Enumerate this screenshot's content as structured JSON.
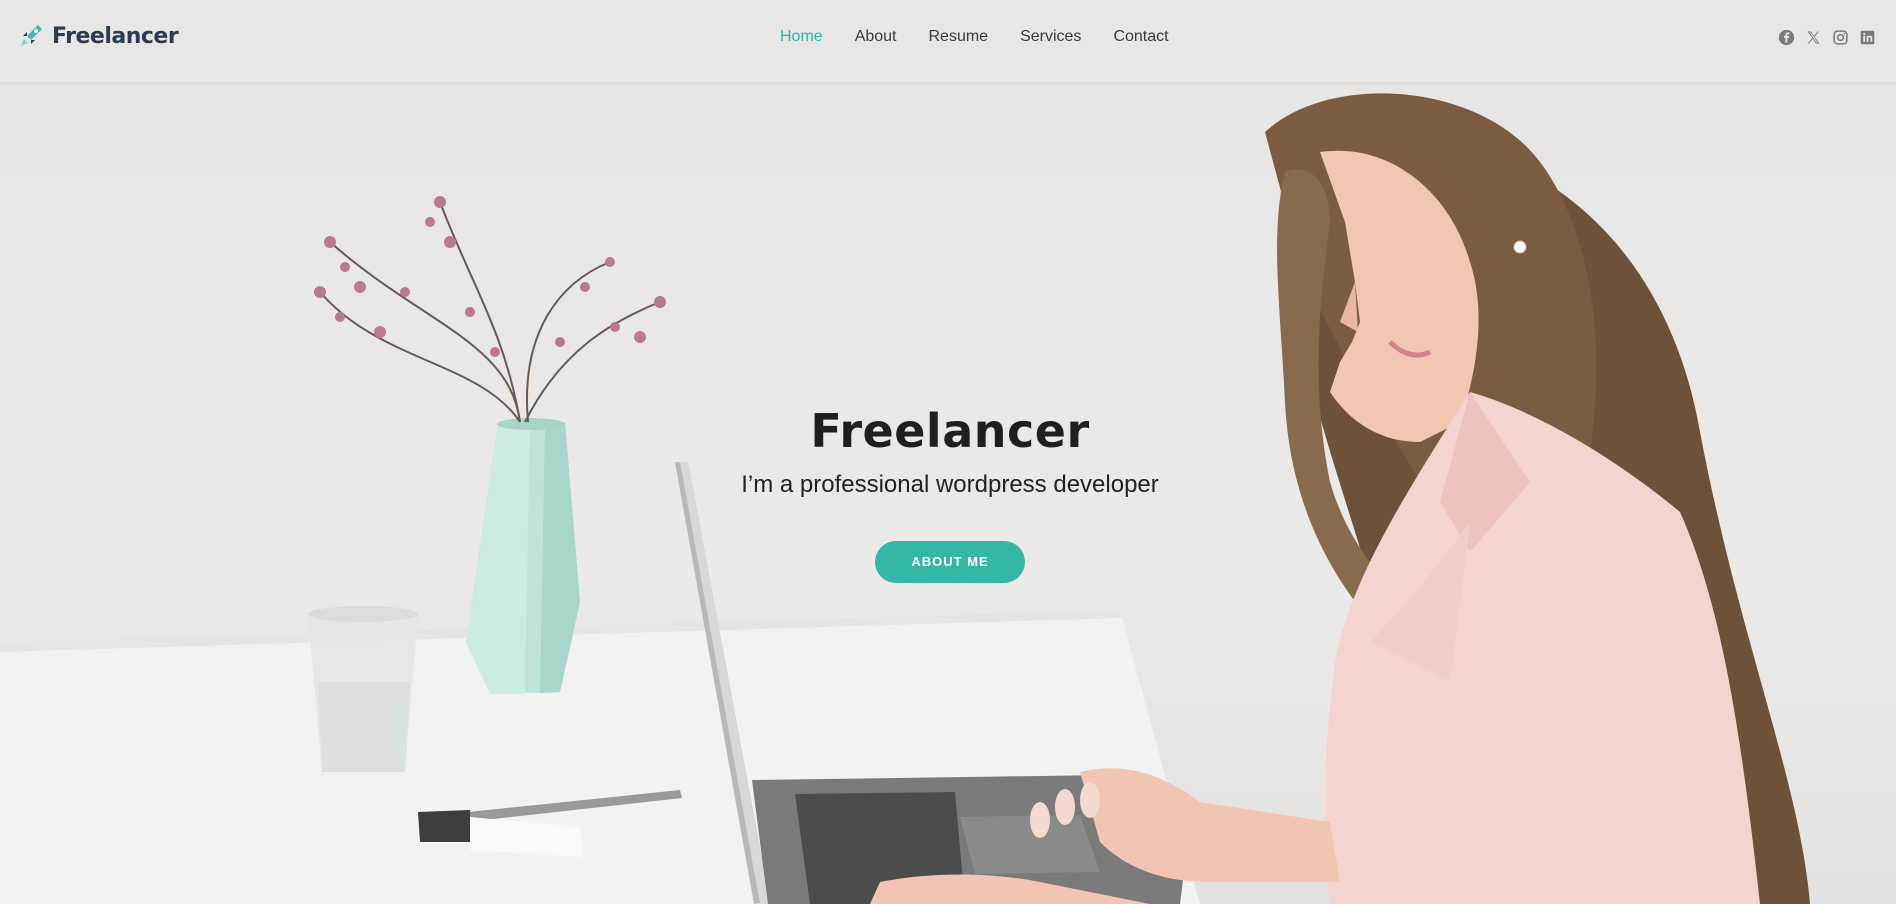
{
  "brand": {
    "name": "Freelancer",
    "accent_color": "#34b7a5",
    "logo_icon": "rocket-icon"
  },
  "nav": {
    "items": [
      {
        "label": "Home",
        "active": true
      },
      {
        "label": "About",
        "active": false
      },
      {
        "label": "Resume",
        "active": false
      },
      {
        "label": "Services",
        "active": false
      },
      {
        "label": "Contact",
        "active": false
      }
    ]
  },
  "social": {
    "icons": [
      "facebook-icon",
      "x-twitter-icon",
      "instagram-icon",
      "linkedin-icon"
    ]
  },
  "hero": {
    "title": "Freelancer",
    "subtitle": "I’m a professional wordpress developer",
    "button_label": "ABOUT ME"
  }
}
